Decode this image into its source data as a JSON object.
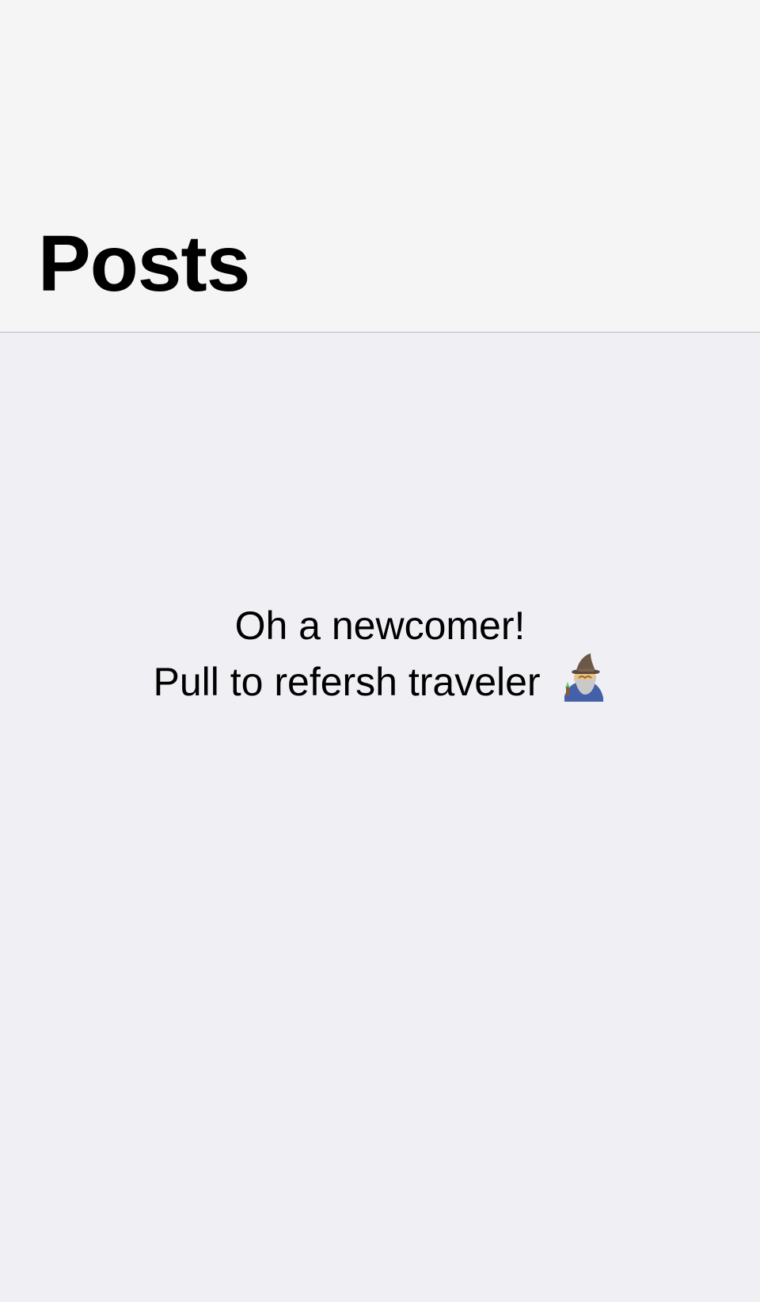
{
  "header": {
    "title": "Posts"
  },
  "empty_state": {
    "line1": "Oh a newcomer!",
    "line2": "Pull to refersh traveler",
    "icon": "wizard-icon"
  },
  "colors": {
    "header_background": "#f5f5f5",
    "content_background": "#f0eff4",
    "separator": "#b9b9bd",
    "text": "#000000"
  }
}
